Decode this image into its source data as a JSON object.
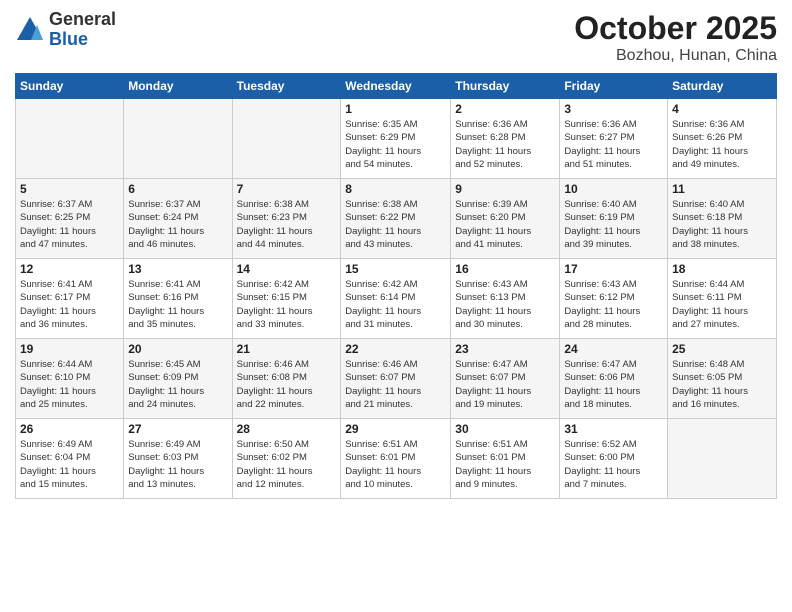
{
  "header": {
    "logo_general": "General",
    "logo_blue": "Blue",
    "month": "October 2025",
    "location": "Bozhou, Hunan, China"
  },
  "weekdays": [
    "Sunday",
    "Monday",
    "Tuesday",
    "Wednesday",
    "Thursday",
    "Friday",
    "Saturday"
  ],
  "weeks": [
    [
      {
        "day": "",
        "info": ""
      },
      {
        "day": "",
        "info": ""
      },
      {
        "day": "",
        "info": ""
      },
      {
        "day": "1",
        "info": "Sunrise: 6:35 AM\nSunset: 6:29 PM\nDaylight: 11 hours\nand 54 minutes."
      },
      {
        "day": "2",
        "info": "Sunrise: 6:36 AM\nSunset: 6:28 PM\nDaylight: 11 hours\nand 52 minutes."
      },
      {
        "day": "3",
        "info": "Sunrise: 6:36 AM\nSunset: 6:27 PM\nDaylight: 11 hours\nand 51 minutes."
      },
      {
        "day": "4",
        "info": "Sunrise: 6:36 AM\nSunset: 6:26 PM\nDaylight: 11 hours\nand 49 minutes."
      }
    ],
    [
      {
        "day": "5",
        "info": "Sunrise: 6:37 AM\nSunset: 6:25 PM\nDaylight: 11 hours\nand 47 minutes."
      },
      {
        "day": "6",
        "info": "Sunrise: 6:37 AM\nSunset: 6:24 PM\nDaylight: 11 hours\nand 46 minutes."
      },
      {
        "day": "7",
        "info": "Sunrise: 6:38 AM\nSunset: 6:23 PM\nDaylight: 11 hours\nand 44 minutes."
      },
      {
        "day": "8",
        "info": "Sunrise: 6:38 AM\nSunset: 6:22 PM\nDaylight: 11 hours\nand 43 minutes."
      },
      {
        "day": "9",
        "info": "Sunrise: 6:39 AM\nSunset: 6:20 PM\nDaylight: 11 hours\nand 41 minutes."
      },
      {
        "day": "10",
        "info": "Sunrise: 6:40 AM\nSunset: 6:19 PM\nDaylight: 11 hours\nand 39 minutes."
      },
      {
        "day": "11",
        "info": "Sunrise: 6:40 AM\nSunset: 6:18 PM\nDaylight: 11 hours\nand 38 minutes."
      }
    ],
    [
      {
        "day": "12",
        "info": "Sunrise: 6:41 AM\nSunset: 6:17 PM\nDaylight: 11 hours\nand 36 minutes."
      },
      {
        "day": "13",
        "info": "Sunrise: 6:41 AM\nSunset: 6:16 PM\nDaylight: 11 hours\nand 35 minutes."
      },
      {
        "day": "14",
        "info": "Sunrise: 6:42 AM\nSunset: 6:15 PM\nDaylight: 11 hours\nand 33 minutes."
      },
      {
        "day": "15",
        "info": "Sunrise: 6:42 AM\nSunset: 6:14 PM\nDaylight: 11 hours\nand 31 minutes."
      },
      {
        "day": "16",
        "info": "Sunrise: 6:43 AM\nSunset: 6:13 PM\nDaylight: 11 hours\nand 30 minutes."
      },
      {
        "day": "17",
        "info": "Sunrise: 6:43 AM\nSunset: 6:12 PM\nDaylight: 11 hours\nand 28 minutes."
      },
      {
        "day": "18",
        "info": "Sunrise: 6:44 AM\nSunset: 6:11 PM\nDaylight: 11 hours\nand 27 minutes."
      }
    ],
    [
      {
        "day": "19",
        "info": "Sunrise: 6:44 AM\nSunset: 6:10 PM\nDaylight: 11 hours\nand 25 minutes."
      },
      {
        "day": "20",
        "info": "Sunrise: 6:45 AM\nSunset: 6:09 PM\nDaylight: 11 hours\nand 24 minutes."
      },
      {
        "day": "21",
        "info": "Sunrise: 6:46 AM\nSunset: 6:08 PM\nDaylight: 11 hours\nand 22 minutes."
      },
      {
        "day": "22",
        "info": "Sunrise: 6:46 AM\nSunset: 6:07 PM\nDaylight: 11 hours\nand 21 minutes."
      },
      {
        "day": "23",
        "info": "Sunrise: 6:47 AM\nSunset: 6:07 PM\nDaylight: 11 hours\nand 19 minutes."
      },
      {
        "day": "24",
        "info": "Sunrise: 6:47 AM\nSunset: 6:06 PM\nDaylight: 11 hours\nand 18 minutes."
      },
      {
        "day": "25",
        "info": "Sunrise: 6:48 AM\nSunset: 6:05 PM\nDaylight: 11 hours\nand 16 minutes."
      }
    ],
    [
      {
        "day": "26",
        "info": "Sunrise: 6:49 AM\nSunset: 6:04 PM\nDaylight: 11 hours\nand 15 minutes."
      },
      {
        "day": "27",
        "info": "Sunrise: 6:49 AM\nSunset: 6:03 PM\nDaylight: 11 hours\nand 13 minutes."
      },
      {
        "day": "28",
        "info": "Sunrise: 6:50 AM\nSunset: 6:02 PM\nDaylight: 11 hours\nand 12 minutes."
      },
      {
        "day": "29",
        "info": "Sunrise: 6:51 AM\nSunset: 6:01 PM\nDaylight: 11 hours\nand 10 minutes."
      },
      {
        "day": "30",
        "info": "Sunrise: 6:51 AM\nSunset: 6:01 PM\nDaylight: 11 hours\nand 9 minutes."
      },
      {
        "day": "31",
        "info": "Sunrise: 6:52 AM\nSunset: 6:00 PM\nDaylight: 11 hours\nand 7 minutes."
      },
      {
        "day": "",
        "info": ""
      }
    ]
  ]
}
